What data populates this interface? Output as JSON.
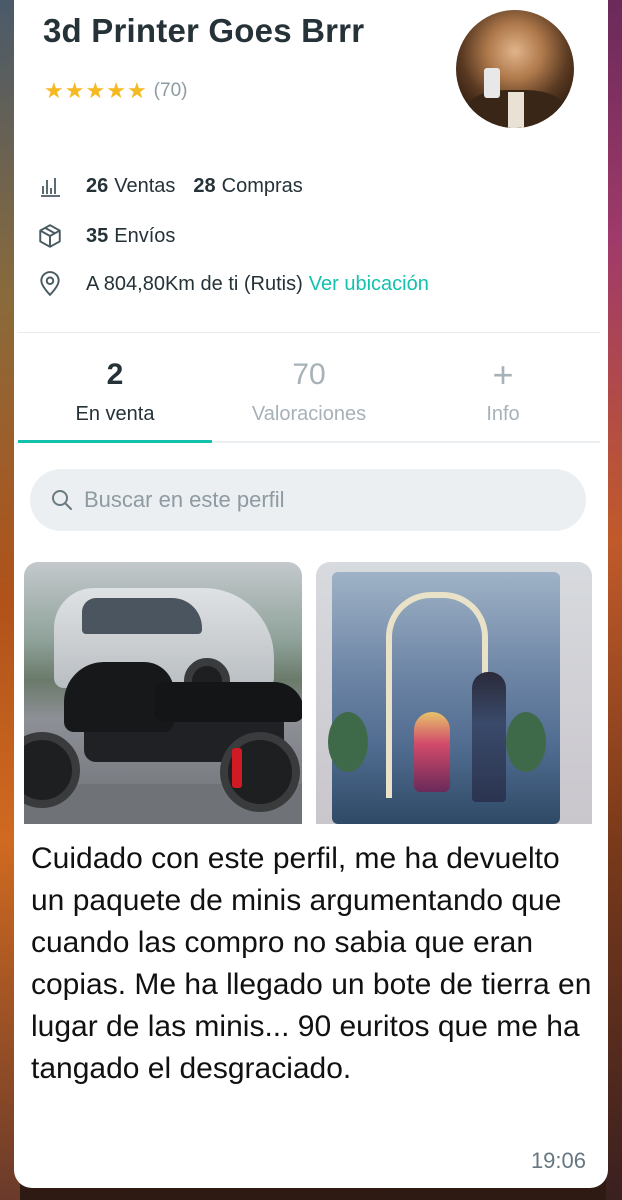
{
  "profile": {
    "name": "3d Printer Goes Brrr",
    "rating_stars": 5,
    "rating_count": "(70)",
    "avatar_icon": "profile-avatar"
  },
  "stats": {
    "sales_count": "26",
    "sales_label": "Ventas",
    "purchases_count": "28",
    "purchases_label": "Compras",
    "shipments_count": "35",
    "shipments_label": "Envíos",
    "location_text": "A 804,80Km de ti (Rutis)",
    "location_link": "Ver ubicación",
    "icons": [
      "bar-chart-icon",
      "box-icon",
      "location-pin-icon"
    ]
  },
  "tabs": [
    {
      "num": "2",
      "label": "En venta",
      "active": true
    },
    {
      "num": "70",
      "label": "Valoraciones",
      "active": false
    },
    {
      "num": "+",
      "label": "Info",
      "active": false
    }
  ],
  "search": {
    "placeholder": "Buscar en este perfil",
    "icon": "search-icon"
  },
  "colors": {
    "accent": "#13c1ac",
    "star": "#f5b921",
    "text": "#253238",
    "muted": "#8e9ba3"
  },
  "message": {
    "text": "Cuidado con este perfil, me ha devuelto un paquete de minis argumentando que cuando las compro no sabia que eran copias. Me ha llegado un bote de tierra en lugar de las minis... 90 euritos que me ha tangado el desgraciado.",
    "time": "19:06"
  }
}
